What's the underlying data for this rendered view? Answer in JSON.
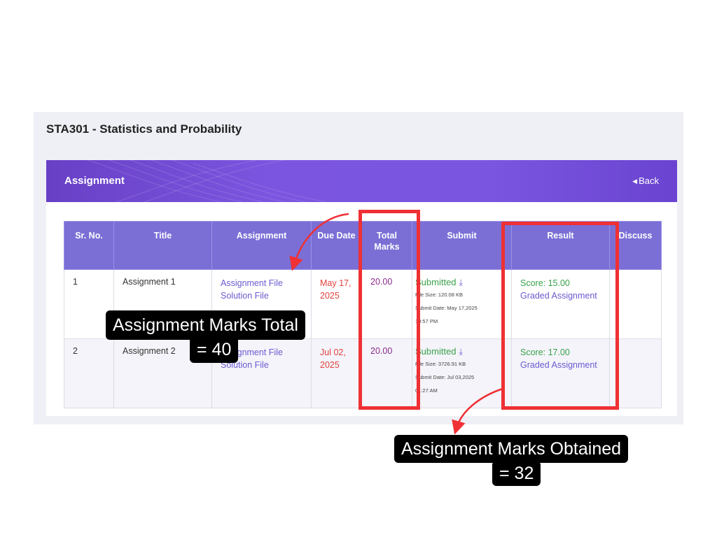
{
  "course": {
    "title": "STA301 - Statistics and Probability"
  },
  "header": {
    "title": "Assignment",
    "back_label": "Back"
  },
  "table": {
    "columns": [
      "Sr. No.",
      "Title",
      "Assignment",
      "Due Date",
      "Total Marks",
      "Submit",
      "Result",
      "Discuss"
    ],
    "rows": [
      {
        "sr": "1",
        "title": "Assignment 1",
        "assignment_file": "Assignment File",
        "solution_file": "Solution File",
        "due_date": "May 17, 2025",
        "total_marks": "20.00",
        "submit_status": "Submitted",
        "file_size": "File Size: 120.08 KB",
        "submit_date": "Submit Date: May 17,2025",
        "submit_time": "10:57 PM",
        "score": "Score: 15.00",
        "graded": "Graded Assignment"
      },
      {
        "sr": "2",
        "title": "Assignment 2",
        "assignment_file": "Assignment File",
        "solution_file": "Solution File",
        "due_date": "Jul 02, 2025",
        "total_marks": "20.00",
        "submit_status": "Submitted",
        "file_size": "File Size: 3726.91 KB",
        "submit_date": "Submit Date: Jul 03,2025",
        "submit_time": "01:27 AM",
        "score": "Score: 17.00",
        "graded": "Graded Assignment"
      }
    ]
  },
  "annotations": {
    "total_line1": "Assignment Marks Total",
    "total_line2": "= 40",
    "obtained_line1": "Assignment Marks Obtained",
    "obtained_line2": "= 32"
  },
  "colors": {
    "header": "#7b55df",
    "accent": "#6a5bd0",
    "highlight": "#ef3034",
    "success": "#3aa14a",
    "due": "#e0423d"
  },
  "icons": [
    "download-icon",
    "back-triangle-icon",
    "arrow-icon"
  ]
}
